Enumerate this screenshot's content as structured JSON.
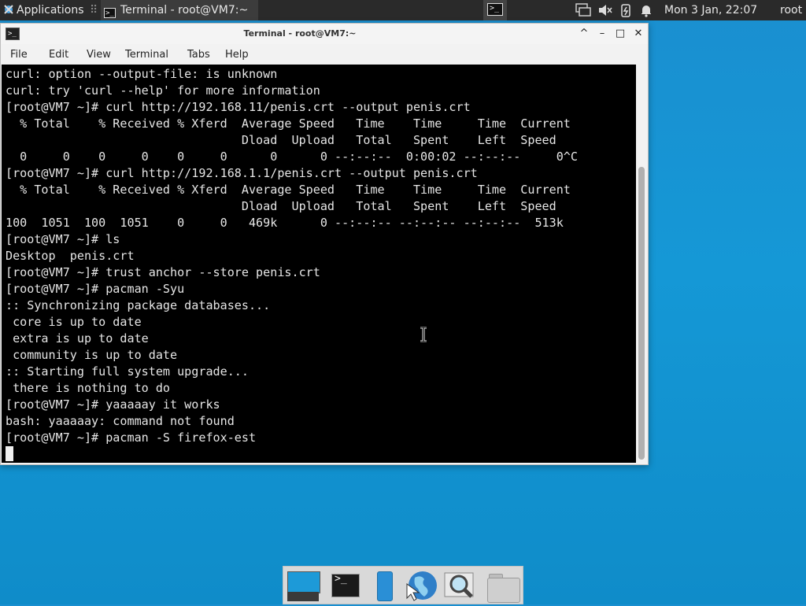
{
  "top_panel": {
    "applications_label": "Applications",
    "task_button_label": "Terminal - root@VM7:~",
    "clock": "Mon  3 Jan, 22:07",
    "user": "root",
    "icons": [
      "applications-icon",
      "terminal-icon",
      "workspace-switcher-icon",
      "network-icon",
      "volume-muted-icon",
      "power-icon",
      "notification-bell-icon"
    ]
  },
  "window": {
    "title": "Terminal - root@VM7:~",
    "menu": [
      "File",
      "Edit",
      "View",
      "Terminal",
      "Tabs",
      "Help"
    ],
    "controls": {
      "up": "^",
      "minimize": "–",
      "maximize": "□",
      "close": "✕"
    },
    "terminal_lines": [
      "curl: option --output-file: is unknown",
      "curl: try 'curl --help' for more information",
      "[root@VM7 ~]# curl http://192.168.11/penis.crt --output penis.crt",
      "  % Total    % Received % Xferd  Average Speed   Time    Time     Time  Current",
      "                                 Dload  Upload   Total   Spent    Left  Speed",
      "  0     0    0     0    0     0      0      0 --:--:--  0:00:02 --:--:--     0^C",
      "[root@VM7 ~]# curl http://192.168.1.1/penis.crt --output penis.crt",
      "  % Total    % Received % Xferd  Average Speed   Time    Time     Time  Current",
      "                                 Dload  Upload   Total   Spent    Left  Speed",
      "100  1051  100  1051    0     0   469k      0 --:--:-- --:--:-- --:--:--  513k",
      "[root@VM7 ~]# ls",
      "Desktop  penis.crt",
      "[root@VM7 ~]# trust anchor --store penis.crt",
      "[root@VM7 ~]# pacman -Syu",
      ":: Synchronizing package databases...",
      " core is up to date",
      " extra is up to date",
      " community is up to date",
      ":: Starting full system upgrade...",
      " there is nothing to do",
      "[root@VM7 ~]# yaaaaay it works",
      "bash: yaaaaay: command not found",
      "[root@VM7 ~]# pacman -S firefox-est"
    ]
  },
  "dock": {
    "items": [
      "show-desktop-icon",
      "terminal-icon",
      "app-finder-icon",
      "web-browser-icon",
      "search-icon",
      "file-manager-icon"
    ]
  },
  "colors": {
    "desktop": "#1598d6",
    "panel": "#2a2a2a",
    "terminal_bg": "#000000",
    "terminal_fg": "#e6e6e6"
  }
}
